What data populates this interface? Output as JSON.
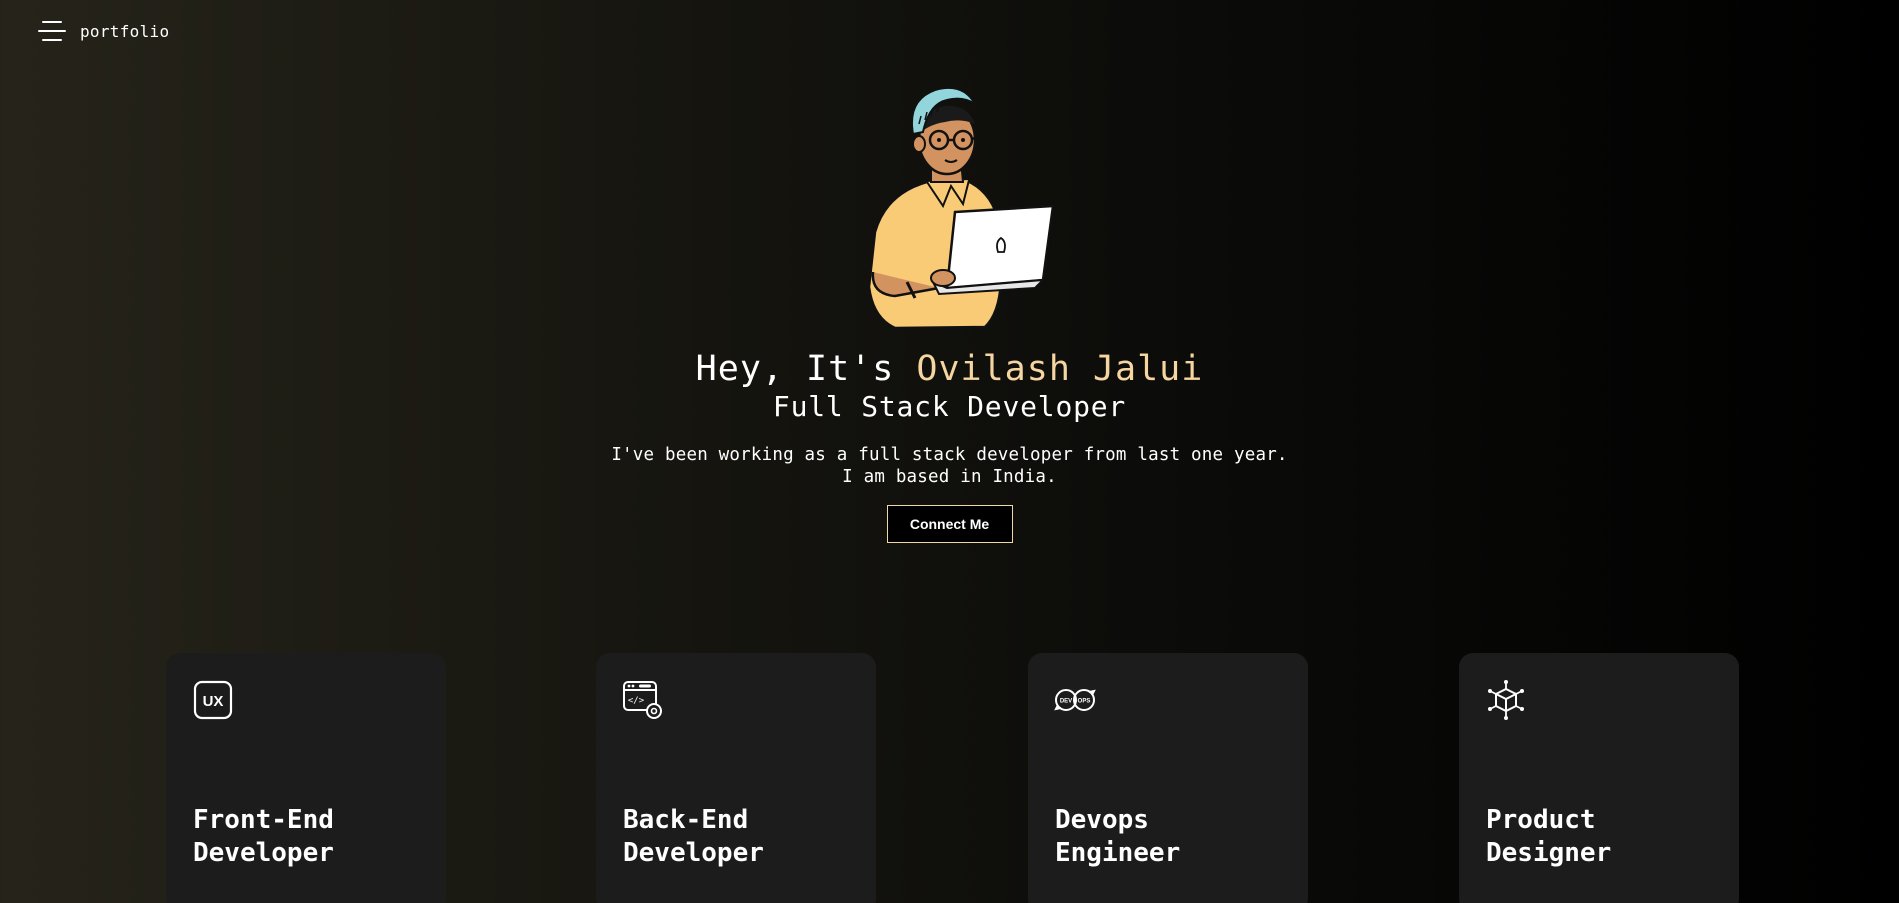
{
  "nav": {
    "menu_icon": "hamburger-menu-icon",
    "brand": "portfolio"
  },
  "hero": {
    "greeting_prefix": "Hey, It's ",
    "name": "Ovilash Jalui",
    "role": "Full Stack Developer",
    "bio_line1": "I've been working as a full stack developer from last one year.",
    "bio_line2": "I am based in India.",
    "cta_label": "Connect Me",
    "accent_color": "#f6d6a0"
  },
  "services": [
    {
      "icon": "ux-icon",
      "title": "Front-End\nDeveloper"
    },
    {
      "icon": "code-settings-icon",
      "title": "Back-End\nDeveloper"
    },
    {
      "icon": "devops-icon",
      "title": "Devops\nEngineer"
    },
    {
      "icon": "product-cube-icon",
      "title": "Product\nDesigner"
    }
  ]
}
